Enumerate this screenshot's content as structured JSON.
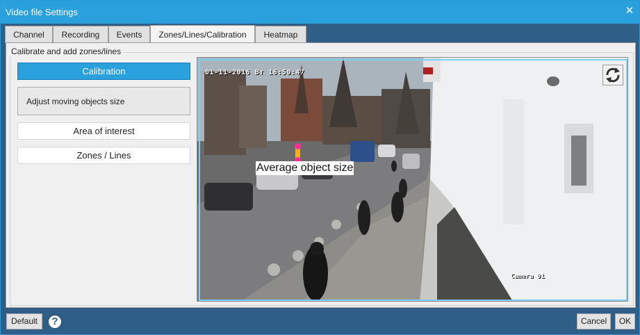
{
  "window": {
    "title": "Video file Settings",
    "close_icon": "close-icon"
  },
  "tabs": [
    {
      "label": "Channel",
      "active": false
    },
    {
      "label": "Recording",
      "active": false
    },
    {
      "label": "Events",
      "active": false
    },
    {
      "label": "Zones/Lines/Calibration",
      "active": true
    },
    {
      "label": "Heatmap",
      "active": false
    }
  ],
  "group": {
    "label": "Calibrate and add zones/lines"
  },
  "sidebar": {
    "calibration": "Calibration",
    "adjust": "Adjust moving objects size",
    "area": "Area of interest",
    "zones": "Zones / Lines"
  },
  "video": {
    "timestamp": "01-11-2016 Вт 16:50:47",
    "camera_label": "Camera 01",
    "overlay_label": "Average object size",
    "rotate_icon": "rotate-arrows-icon"
  },
  "footer": {
    "default": "Default",
    "help": "?",
    "cancel": "Cancel",
    "ok": "OK"
  },
  "colors": {
    "accent": "#2aa0dc",
    "handle": "#ff2e90",
    "size_bar": "#ffb000"
  }
}
